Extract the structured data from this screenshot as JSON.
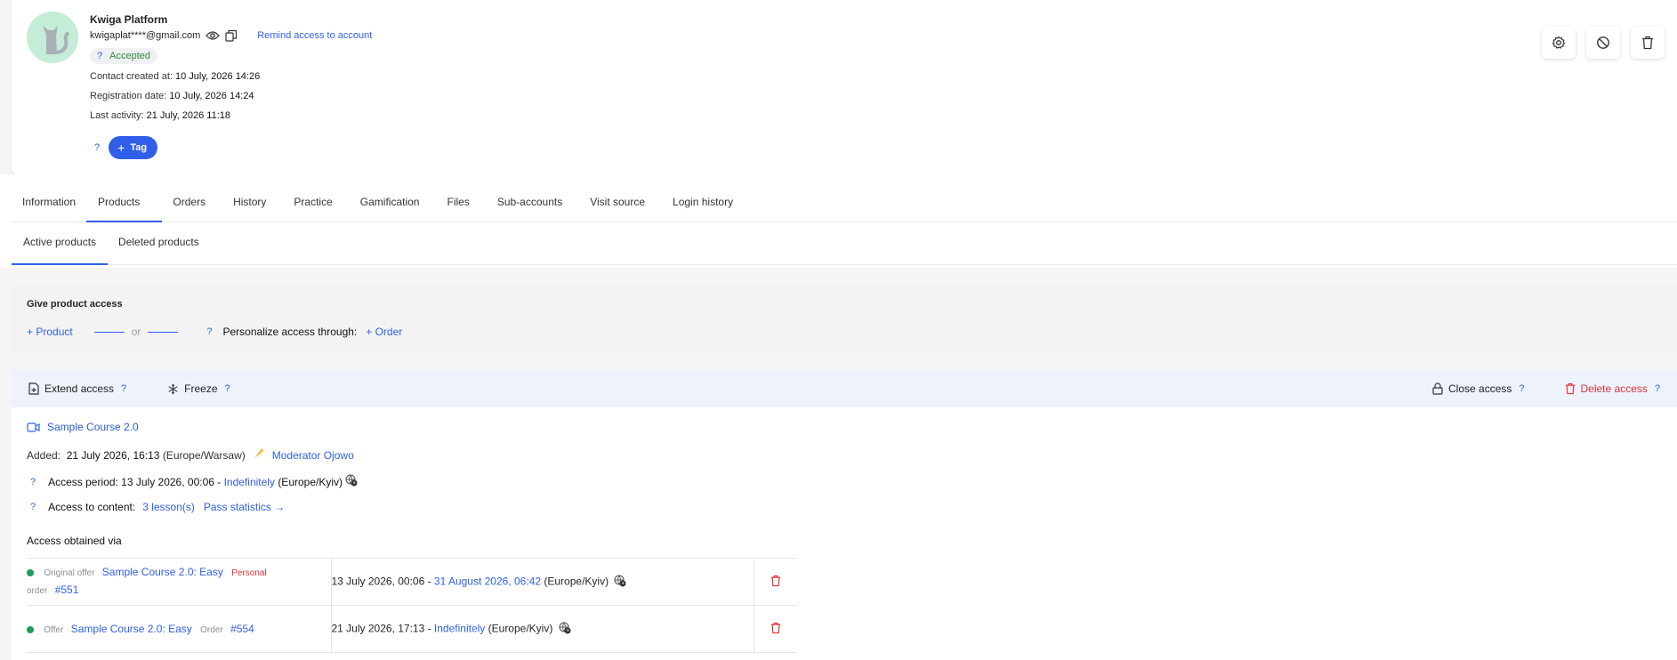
{
  "profile": {
    "name": "Kwiga Platform",
    "email": "kwigaplat****@gmail.com",
    "remind_label": "Remind access to account",
    "status_help": "?",
    "status": "Accepted",
    "contact_created_label": "Contact created at:",
    "contact_created_value": "10 July, 2026 14:26",
    "registration_label": "Registration date:",
    "registration_value": "10 July, 2026 14:24",
    "last_activity_label": "Last activity:",
    "last_activity_value": "21 July, 2026 11:18",
    "tags_help": "?",
    "tag_button_label": "Tag"
  },
  "tabs": [
    "Information",
    "Products",
    "Orders",
    "History",
    "Practice",
    "Gamification",
    "Files",
    "Sub-accounts",
    "Visit source",
    "Login history"
  ],
  "subtabs": [
    "Active products",
    "Deleted products"
  ],
  "give_access": {
    "title": "Give product access",
    "product_link": "+ Product",
    "or_text": "or",
    "help": "?",
    "personalize_label": "Personalize access through:",
    "order_link": "+ Order"
  },
  "toolbar": {
    "extend_label": "Extend access",
    "freeze_label": "Freeze",
    "close_label": "Close access",
    "delete_label": "Delete access",
    "help": "?"
  },
  "course": {
    "title": "Sample Course 2.0",
    "added_label": "Added:",
    "added_value": "21 July 2026, 16:13",
    "added_tz": "(Europe/Warsaw)",
    "moderator": "Moderator Ojowo",
    "access_help": "?",
    "access_period_label": "Access period:",
    "access_period_start": "13 July 2026, 00:06 -",
    "access_period_end": "Indefinitely",
    "access_period_tz": "(Europe/Kyiv)",
    "content_label": "Access to content:",
    "lessons_link": "3 lesson(s)",
    "stats_link": "Pass statistics →",
    "obtained_title": "Access obtained via"
  },
  "offers": [
    {
      "type_label": "Original offer",
      "offer_name": "Sample Course 2.0: Easy",
      "personal": "Personal",
      "order_label": "order",
      "order_number": "#551",
      "period_start": "13 July 2026, 00:06 -",
      "period_end": "31 August 2026, 06:42",
      "tz": "(Europe/Kyiv)"
    },
    {
      "type_label": "Offer",
      "offer_name": "Sample Course 2.0: Easy",
      "order_label": "Order",
      "order_number": "#554",
      "period_start": "21 July 2026, 17:13 -",
      "period_end": "Indefinitely",
      "tz": "(Europe/Kyiv)"
    }
  ],
  "colors": {
    "accent": "#2f5fe8",
    "danger": "#e0323a",
    "success": "#1d9a5a",
    "avatar_bg": "#c5ecd6"
  },
  "icons": [
    "eye-icon",
    "copy-icon",
    "settings-icon",
    "block-icon",
    "trash-icon",
    "file-plus-icon",
    "snowflake-icon",
    "lock-icon",
    "video-icon",
    "globe-clock-icon",
    "moderator-icon"
  ]
}
